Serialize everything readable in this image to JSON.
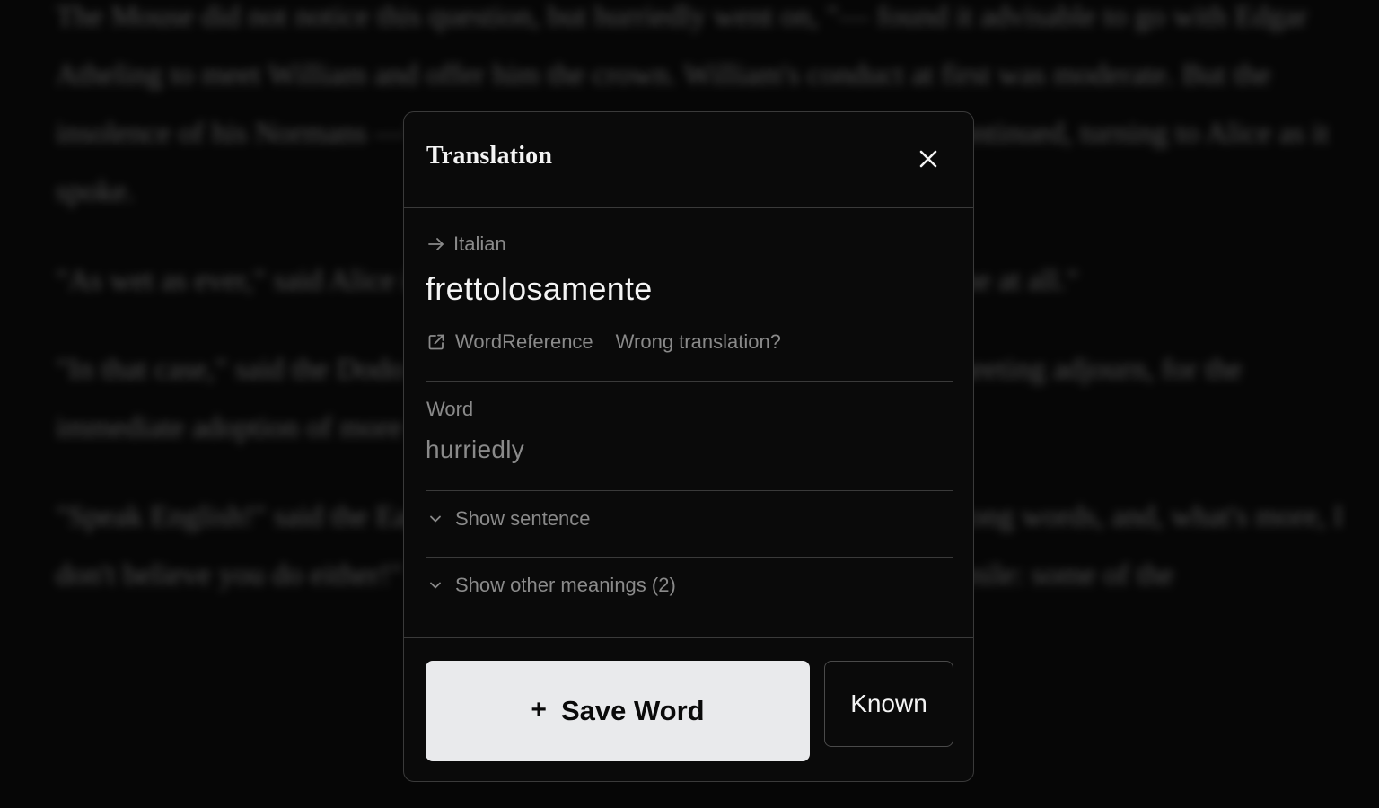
{
  "background": {
    "paragraphs": [
      "The Mouse did not notice this question, but hurriedly went on, \"— found it advisable to go with Edgar Atheling to meet William and offer him the crown. William's conduct at first was moderate. But the insolence of his Normans —\" How are you getting on now, my dear?\" it continued, turning to Alice as it spoke.",
      "\"As wet as ever,\" said Alice in a melancholy tone: \"it doesn't seem to dry me at all.\"",
      "\"In that case,\" said the Dodo solemnly, rising to its feet, \"I move that the meeting adjourn, for the immediate adoption of more energetic remedies —\"",
      "\"Speak English!\" said the Eaglet. \"I don't know the meaning of half those long words, and, what's more, I don't believe you do either!\" And the Eaglet bent down its head to hide a smile: some of the"
    ]
  },
  "modal": {
    "title": "Translation",
    "close_icon": "close-icon",
    "language": "Italian",
    "translation": "frettolosamente",
    "links": {
      "wordreference": "WordReference",
      "wrong": "Wrong translation?"
    },
    "word_label": "Word",
    "word_value": "hurriedly",
    "show_sentence": "Show sentence",
    "show_other_meanings": "Show other meanings (2)",
    "save_button": {
      "icon": "+",
      "label": "Save Word"
    },
    "known_button": "Known"
  },
  "colors": {
    "background": "#060606",
    "modal_bg": "#0a0a0a",
    "border": "#3a3a3a",
    "text_primary": "#f4f4f4",
    "text_muted": "#8a8a8a",
    "save_button_bg": "#e9eaec"
  }
}
